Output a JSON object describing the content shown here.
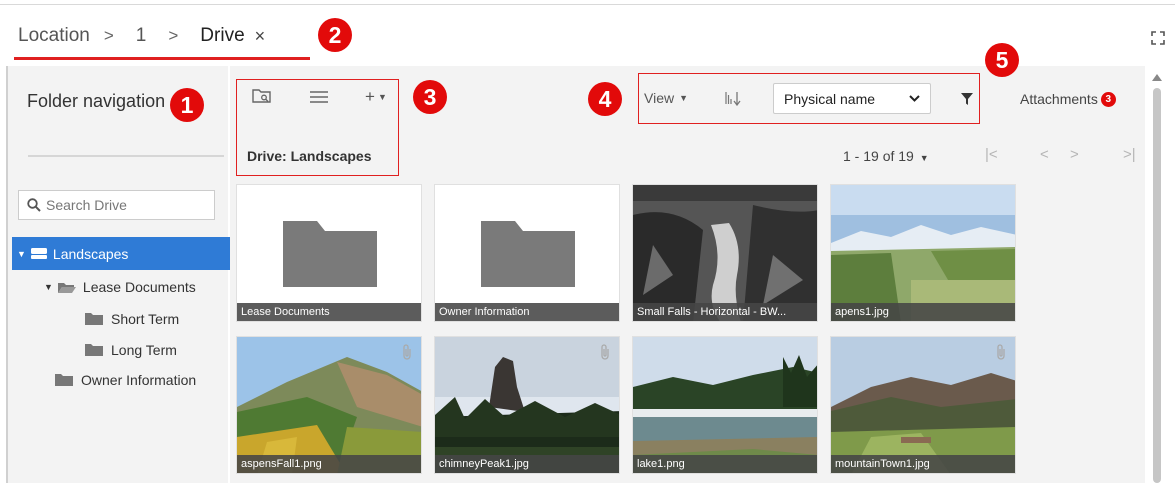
{
  "breadcrumb": {
    "items": [
      "Location",
      "1",
      "Drive"
    ],
    "separator": ">",
    "close_glyph": "×"
  },
  "badges": [
    "1",
    "2",
    "3",
    "4",
    "5"
  ],
  "sidebar": {
    "title": "Folder navigation",
    "search_placeholder": "Search Drive",
    "tree": [
      {
        "label": "Landscapes",
        "icon": "drive-icon",
        "selected": true
      },
      {
        "label": "Lease Documents",
        "icon": "folder-open-icon"
      },
      {
        "label": "Short Term",
        "icon": "folder-icon"
      },
      {
        "label": "Long Term",
        "icon": "folder-icon"
      },
      {
        "label": "Owner Information",
        "icon": "folder-icon"
      }
    ]
  },
  "toolbar": {
    "add_glyph": "+",
    "drive_label": "Drive:  Landscapes",
    "view_label": "View",
    "sort_field": "Physical name",
    "attachments_label": "Attachments",
    "attachments_count": "3",
    "paging": "1 - 19 of 19",
    "nav_first": "|<",
    "nav_prev": "<",
    "nav_next": ">",
    "nav_last": ">|"
  },
  "items": [
    {
      "name": "Lease Documents",
      "type": "folder"
    },
    {
      "name": "Owner Information",
      "type": "folder"
    },
    {
      "name": "Small Falls - Horizontal - BW...",
      "type": "image"
    },
    {
      "name": "apens1.jpg",
      "type": "image"
    },
    {
      "name": "aspensFall1.png",
      "type": "image",
      "attachment": true
    },
    {
      "name": "chimneyPeak1.jpg",
      "type": "image",
      "attachment": true
    },
    {
      "name": "lake1.png",
      "type": "image"
    },
    {
      "name": "mountainTown1.jpg",
      "type": "image",
      "attachment": true
    }
  ],
  "colors": {
    "accent": "#2f7bd6",
    "highlight": "#e20a0a"
  }
}
